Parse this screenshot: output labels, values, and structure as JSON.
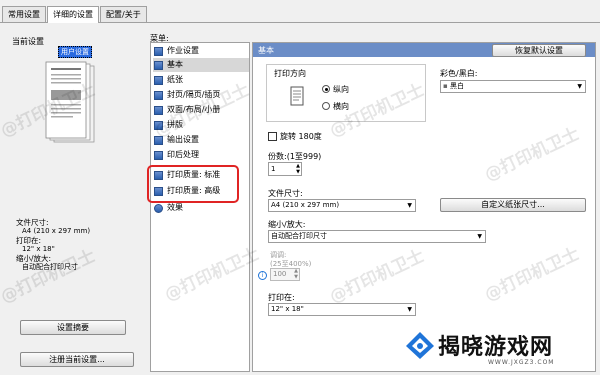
{
  "tabs": [
    {
      "label": "常用设置"
    },
    {
      "label": "详细的设置"
    },
    {
      "label": "配置/关于"
    }
  ],
  "left": {
    "current_settings_label": "当前设置",
    "preset_tag": "用户设置",
    "info": {
      "paper_size_label": "文件尺寸:",
      "paper_size_value": "A4 (210 x 297 mm)",
      "print_on_label": "打印在:",
      "print_on_value": "12\" x 18\"",
      "scale_label": "缩小/放大:",
      "scale_value": "自动配合打印尺寸"
    },
    "summary_button": "设置摘要",
    "register_button": "注册当前设置..."
  },
  "menu": {
    "label": "菜单:",
    "items": [
      {
        "label": "作业设置",
        "icon": "job-settings-icon"
      },
      {
        "label": "基本",
        "icon": "basic-icon"
      },
      {
        "label": "纸张",
        "icon": "paper-icon"
      },
      {
        "label": "封页/隔页/插页",
        "icon": "cover-icon"
      },
      {
        "label": "双面/布局/小册",
        "icon": "duplex-icon"
      },
      {
        "label": "拼版",
        "icon": "imposition-icon"
      },
      {
        "label": "输出设置",
        "icon": "output-icon"
      },
      {
        "label": "印后处理",
        "icon": "finishing-icon"
      },
      {
        "label": "打印质量: 标准",
        "icon": "quality-standard-icon"
      },
      {
        "label": "打印质量: 高级",
        "icon": "quality-advanced-icon"
      },
      {
        "label": "效果",
        "icon": "effects-icon"
      }
    ],
    "selected": "基本",
    "highlight_color": "#e02424"
  },
  "main": {
    "header_title": "基本",
    "restore_button": "恢复默认设置",
    "orientation_label": "打印方向",
    "portrait_label": "纵向",
    "landscape_label": "横向",
    "color_label": "彩色/黑白:",
    "color_value": "黑白",
    "rotate_label": "旋转 180度",
    "rotate_checked": false,
    "copies_label": "份数:(1至999)",
    "copies_value": "1",
    "paper_size_label": "文件尺寸:",
    "paper_size_value": "A4 (210 x 297 mm)",
    "custom_size_button": "自定义纸张尺寸...",
    "scale_label": "缩小/放大:",
    "scale_value": "自动配合打印尺寸",
    "zoom_label": "调调:",
    "zoom_range": "(25至400%)",
    "zoom_value": "100",
    "print_on_label": "打印在:",
    "print_on_value": "12\" x 18\""
  },
  "watermark": {
    "text": "@打印机卫士",
    "logo_text": "揭晓游戏网",
    "logo_url_text": "WWW.JXGZ3.COM"
  },
  "colors": {
    "header": "#6b8dc7",
    "brand_blue": "#1f74d8",
    "highlight_red": "#e02424"
  }
}
